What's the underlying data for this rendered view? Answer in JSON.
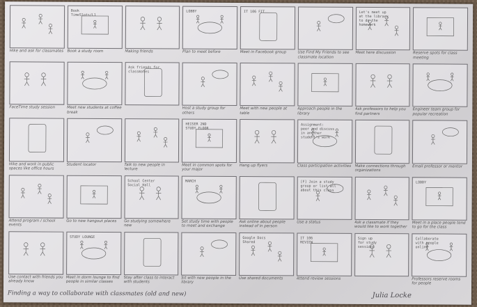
{
  "footer": {
    "title": "Finding a way to collaborate with classmates (old and new)",
    "author": "Julia Locke"
  },
  "cells": [
    {
      "frame": "",
      "caption": "Hike and ask for classmates",
      "icon": "figures-scatter-icon"
    },
    {
      "frame": "Book\nTimeSlots/L1",
      "caption": "Book a study room",
      "icon": "laptop-icon"
    },
    {
      "frame": "",
      "caption": "Making friends",
      "icon": "phone-icon"
    },
    {
      "frame": "LOBBY",
      "caption": "Plan to meet before",
      "icon": "meeting-figures-icon"
    },
    {
      "frame": "IT 106 FIT",
      "caption": "Meet in Facebook group",
      "icon": "post-list-icon"
    },
    {
      "frame": "",
      "caption": "Use Find My Friends to see classmate location",
      "icon": "phone-map-icon"
    },
    {
      "frame": "Let's meet up\nat the library\nto do the\nhomework",
      "caption": "Meet here discussion",
      "icon": "speech-bubble-icon"
    },
    {
      "frame": "",
      "caption": "Reserve spots for class meeting",
      "icon": "music-notes-icon"
    },
    {
      "frame": "",
      "caption": "FaceTime study session",
      "icon": "facetime-icon"
    },
    {
      "frame": "",
      "caption": "Meet new students at coffee break",
      "icon": "table-figures-icon"
    },
    {
      "frame": "Ask friends for classmates",
      "caption": "",
      "icon": "two-figures-icon"
    },
    {
      "frame": "",
      "caption": "Host a study group for others",
      "icon": "board-figures-icon"
    },
    {
      "frame": "",
      "caption": "Meet with new people at table",
      "icon": "round-table-icon"
    },
    {
      "frame": "",
      "caption": "Approach people in the library",
      "icon": "library-figure-icon"
    },
    {
      "frame": "",
      "caption": "Ask professors to help you find partners",
      "icon": "professor-icon"
    },
    {
      "frame": "",
      "caption": "Engineer team group for popular recreation",
      "icon": "crowd-icon"
    },
    {
      "frame": "",
      "caption": "Hike and work in public spaces like office hours",
      "icon": "walking-figures-icon"
    },
    {
      "frame": "",
      "caption": "Student locator",
      "icon": "phone-list-icon"
    },
    {
      "frame": "",
      "caption": "Talk to new people in lecture",
      "icon": "lecture-icon"
    },
    {
      "frame": "HEISER 2ND\nSTUDY FLOOR",
      "caption": "Meet in common spots for your major",
      "icon": "floor-figures-icon"
    },
    {
      "frame": "",
      "caption": "Hang up flyers",
      "icon": "flyer-icon"
    },
    {
      "frame": "Assignment:\npeer and discuss\nin another\nstudent's work",
      "caption": "Class participation activities",
      "icon": "assignment-icon"
    },
    {
      "frame": "",
      "caption": "Make connections through organizations",
      "icon": "connections-icon"
    },
    {
      "frame": "",
      "caption": "Email professor or mentor",
      "icon": "email-icon"
    },
    {
      "frame": "",
      "caption": "Attend program / school events",
      "icon": "event-figures-icon"
    },
    {
      "frame": "",
      "caption": "Go to new hangout places",
      "icon": "phone-app-icon"
    },
    {
      "frame": "School Center\nSocial Hall",
      "caption": "Go studying somewhere new",
      "icon": "building-icon"
    },
    {
      "frame": "MARCH",
      "caption": "Set study time with people to meet and exchange",
      "icon": "calendar-icon"
    },
    {
      "frame": "",
      "caption": "Ask online about people instead of in person",
      "icon": "forum-icon"
    },
    {
      "frame": "[F] Join a study\ngroup or list all\nabout this class",
      "caption": "Use a status",
      "icon": "status-post-icon"
    },
    {
      "frame": "",
      "caption": "Ask a classmate if they would like to work together",
      "icon": "ask-classmate-icon"
    },
    {
      "frame": "LOBBY",
      "caption": "Meet in a place people tend to go for the class",
      "icon": "lobby-figures-icon"
    },
    {
      "frame": "",
      "caption": "Use contact with friends you already know",
      "icon": "contact-figures-icon"
    },
    {
      "frame": "STUDY LOUNGE",
      "caption": "Meet in dorm lounge to find people in similar classes",
      "icon": "lounge-icon"
    },
    {
      "frame": "",
      "caption": "Stay after class to interact with students",
      "icon": "classroom-figures-icon"
    },
    {
      "frame": "",
      "caption": "Sit with new people in the library",
      "icon": "library-table-icon"
    },
    {
      "frame": "Google Docs\nShared",
      "caption": "Use shared documents",
      "icon": "shared-doc-icon"
    },
    {
      "frame": "IT 106\nREVIEW",
      "caption": "Attend review sessions",
      "icon": "review-icon"
    },
    {
      "frame": "Sign up\nfor study\nsessions",
      "caption": "",
      "icon": "vote-icon"
    },
    {
      "frame": "Collaborate\nwith people\nonline",
      "caption": "Professors reserve rooms for people",
      "icon": "collab-note-icon"
    }
  ]
}
